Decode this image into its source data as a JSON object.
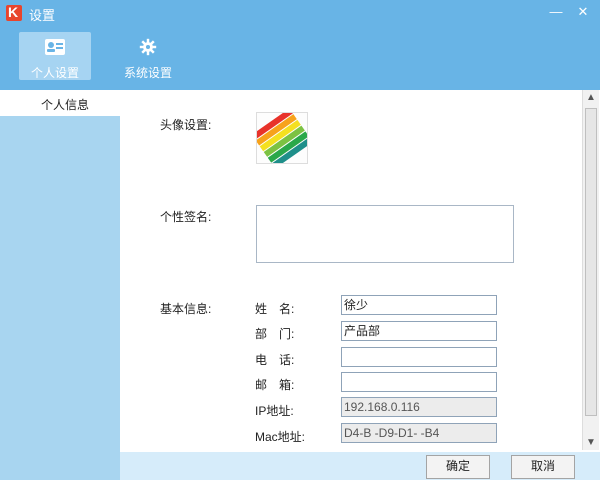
{
  "window": {
    "title": "设置",
    "minimize_glyph": "—",
    "close_glyph": "✕",
    "app_icon": "K"
  },
  "toolbar": {
    "tabs": [
      {
        "label": "个人设置",
        "icon": "contact-card-icon",
        "active": true
      },
      {
        "label": "系统设置",
        "icon": "gear-icon",
        "active": false
      }
    ]
  },
  "sidebar": {
    "items": [
      {
        "label": "个人信息",
        "selected": true
      }
    ]
  },
  "content": {
    "avatar_label": "头像设置:",
    "signature_label": "个性签名:",
    "signature_value": "",
    "basic_label": "基本信息:",
    "fields": [
      {
        "label": "姓　名:",
        "value": "徐少",
        "readonly": false
      },
      {
        "label": "部　门:",
        "value": "产品部",
        "readonly": false
      },
      {
        "label": "电　话:",
        "value": "",
        "readonly": false
      },
      {
        "label": "邮　箱:",
        "value": "",
        "readonly": false
      },
      {
        "label": "IP地址:",
        "value": "192.168.0.116",
        "readonly": true
      },
      {
        "label": "Mac地址:",
        "value": "D4-B -D9-D1-  -B4",
        "readonly": true
      }
    ]
  },
  "buttons": {
    "ok": "确定",
    "cancel": "取消"
  },
  "colors": {
    "accent": "#68b4e6",
    "sidebar": "#a8d5f0",
    "bottom_bar": "#d6ecfa"
  }
}
